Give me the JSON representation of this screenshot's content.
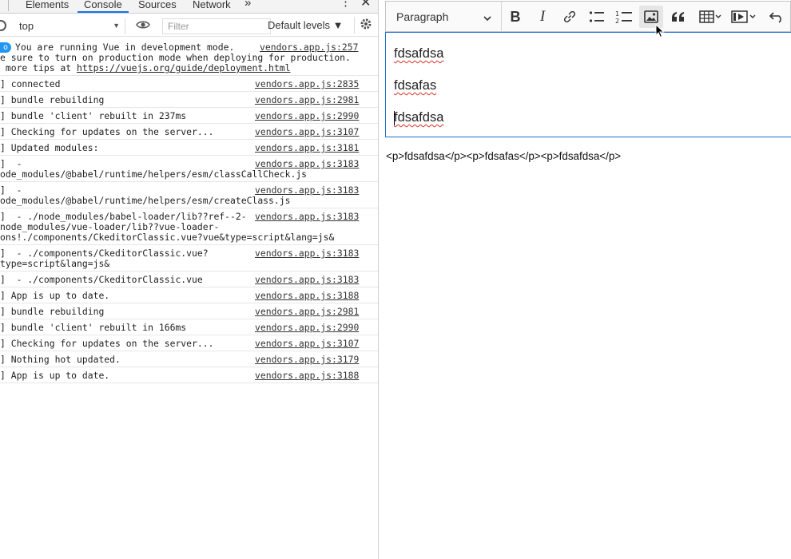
{
  "devtools": {
    "tabs": [
      "Elements",
      "Console",
      "Sources",
      "Network"
    ],
    "active_tab": "Console",
    "more_tabs_label": "»",
    "context": "top",
    "filter_placeholder": "Filter",
    "levels_label": "Default levels ▼",
    "messages": [
      {
        "lines": [
          "You are running Vue in development mode.",
          "e sure to turn on production mode when deploying for production.",
          " more tips at https://vuejs.org/guide/deployment.html"
        ],
        "source": "vendors.app.js:257",
        "badge": "o"
      },
      {
        "lines": [
          "] connected"
        ],
        "source": "vendors.app.js:2835"
      },
      {
        "lines": [
          "] bundle rebuilding"
        ],
        "source": "vendors.app.js:2981"
      },
      {
        "lines": [
          "] bundle 'client' rebuilt in 237ms"
        ],
        "source": "vendors.app.js:2990"
      },
      {
        "lines": [
          "] Checking for updates on the server..."
        ],
        "source": "vendors.app.js:3107"
      },
      {
        "lines": [
          "] Updated modules:"
        ],
        "source": "vendors.app.js:3181"
      },
      {
        "lines": [
          "]  -",
          "ode_modules/@babel/runtime/helpers/esm/classCallCheck.js"
        ],
        "source": "vendors.app.js:3183"
      },
      {
        "lines": [
          "]  -",
          "ode_modules/@babel/runtime/helpers/esm/createClass.js"
        ],
        "source": "vendors.app.js:3183"
      },
      {
        "lines": [
          "]  - ./node_modules/babel-loader/lib??ref--2-",
          "node_modules/vue-loader/lib??vue-loader-",
          "ons!./components/CkeditorClassic.vue?vue&type=script&lang=js&"
        ],
        "source": "vendors.app.js:3183"
      },
      {
        "lines": [
          "]  - ./components/CkeditorClassic.vue?",
          "type=script&lang=js&"
        ],
        "source": "vendors.app.js:3183"
      },
      {
        "lines": [
          "]  - ./components/CkeditorClassic.vue"
        ],
        "source": "vendors.app.js:3183"
      },
      {
        "lines": [
          "] App is up to date."
        ],
        "source": "vendors.app.js:3188"
      },
      {
        "lines": [
          "] bundle rebuilding"
        ],
        "source": "vendors.app.js:2981"
      },
      {
        "lines": [
          "] bundle 'client' rebuilt in 166ms"
        ],
        "source": "vendors.app.js:2990"
      },
      {
        "lines": [
          "] Checking for updates on the server..."
        ],
        "source": "vendors.app.js:3107"
      },
      {
        "lines": [
          "] Nothing hot updated."
        ],
        "source": "vendors.app.js:3179"
      },
      {
        "lines": [
          "] App is up to date."
        ],
        "source": "vendors.app.js:3188"
      }
    ]
  },
  "editor": {
    "heading_select": "Paragraph",
    "toolbar_icons": [
      "bold-icon",
      "italic-icon",
      "link-icon",
      "bulleted-list-icon",
      "numbered-list-icon",
      "image-icon",
      "blockquote-icon",
      "table-icon",
      "media-icon",
      "undo-icon"
    ],
    "active_tool": "image-icon",
    "paragraphs": [
      "fdsafdsa",
      "fdsafas",
      "fdsafdsa"
    ],
    "output_html": "<p>fdsafdsa</p><p>fdsafas</p><p>fdsafdsa</p>",
    "accent_color": "#1c6fd6"
  }
}
